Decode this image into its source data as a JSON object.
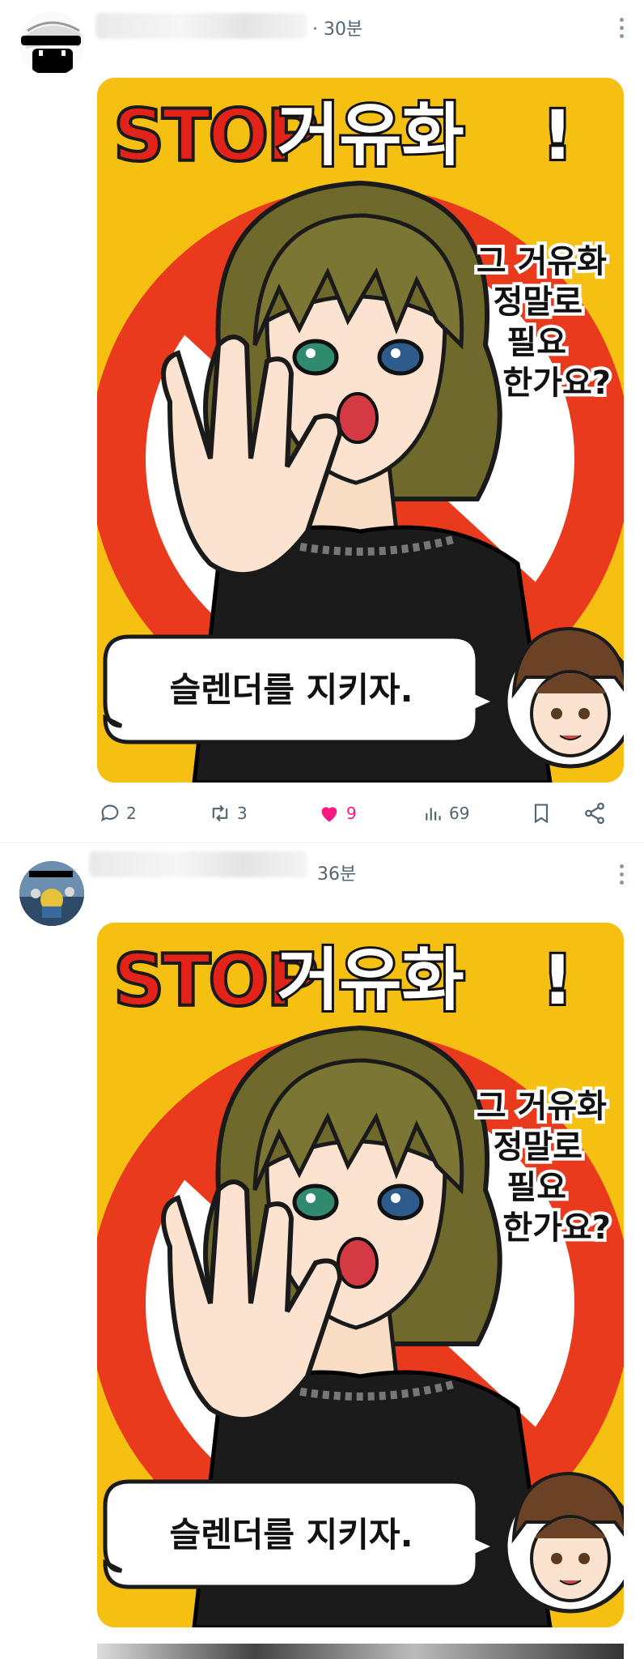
{
  "posts": [
    {
      "time": "30분",
      "image": {
        "stop_word": "STOP",
        "title_word": "거유화",
        "exclaim": "!",
        "question_lines": [
          "그 거유화",
          "정말로",
          "필요",
          "한가요?"
        ],
        "bubble": "슬렌더를 지키자."
      },
      "actions": {
        "replies": "2",
        "reposts": "3",
        "likes": "9",
        "views": "69"
      }
    },
    {
      "time": "36분",
      "image": {
        "stop_word": "STOP",
        "title_word": "거유화",
        "exclaim": "!",
        "question_lines": [
          "그 거유화",
          "정말로",
          "필요",
          "한가요?"
        ],
        "bubble": "슬렌더를 지키자."
      }
    }
  ],
  "colors": {
    "poster_yellow": "#f6c012",
    "stop_red": "#e2231a",
    "like_pink": "#f91880",
    "meta_gray": "#536471"
  }
}
